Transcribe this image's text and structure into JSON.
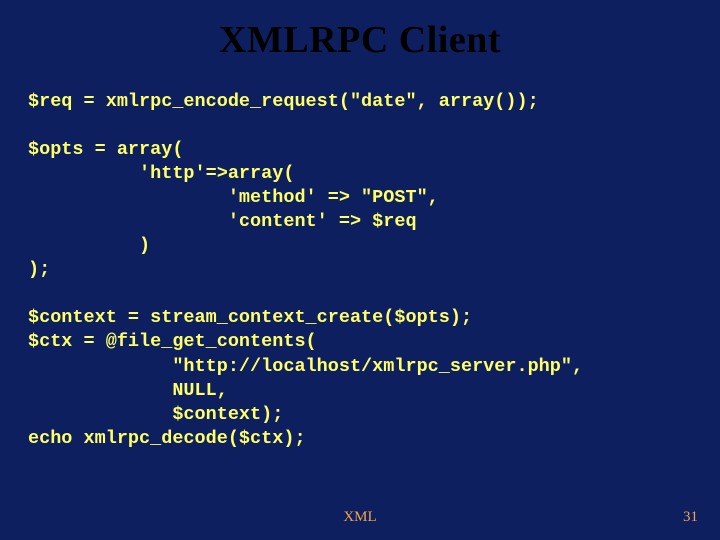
{
  "title": "XMLRPC Client",
  "code_lines": [
    "$req = xmlrpc_encode_request(\"date\", array());",
    "",
    "$opts = array(",
    "          'http'=>array(",
    "                  'method' => \"POST\",",
    "                  'content' => $req",
    "          )",
    ");",
    "",
    "$context = stream_context_create($opts);",
    "$ctx = @file_get_contents(",
    "             \"http://localhost/xmlrpc_server.php\",",
    "             NULL,",
    "             $context);",
    "echo xmlrpc_decode($ctx);"
  ],
  "footer": {
    "center": "XML",
    "page": "31"
  }
}
